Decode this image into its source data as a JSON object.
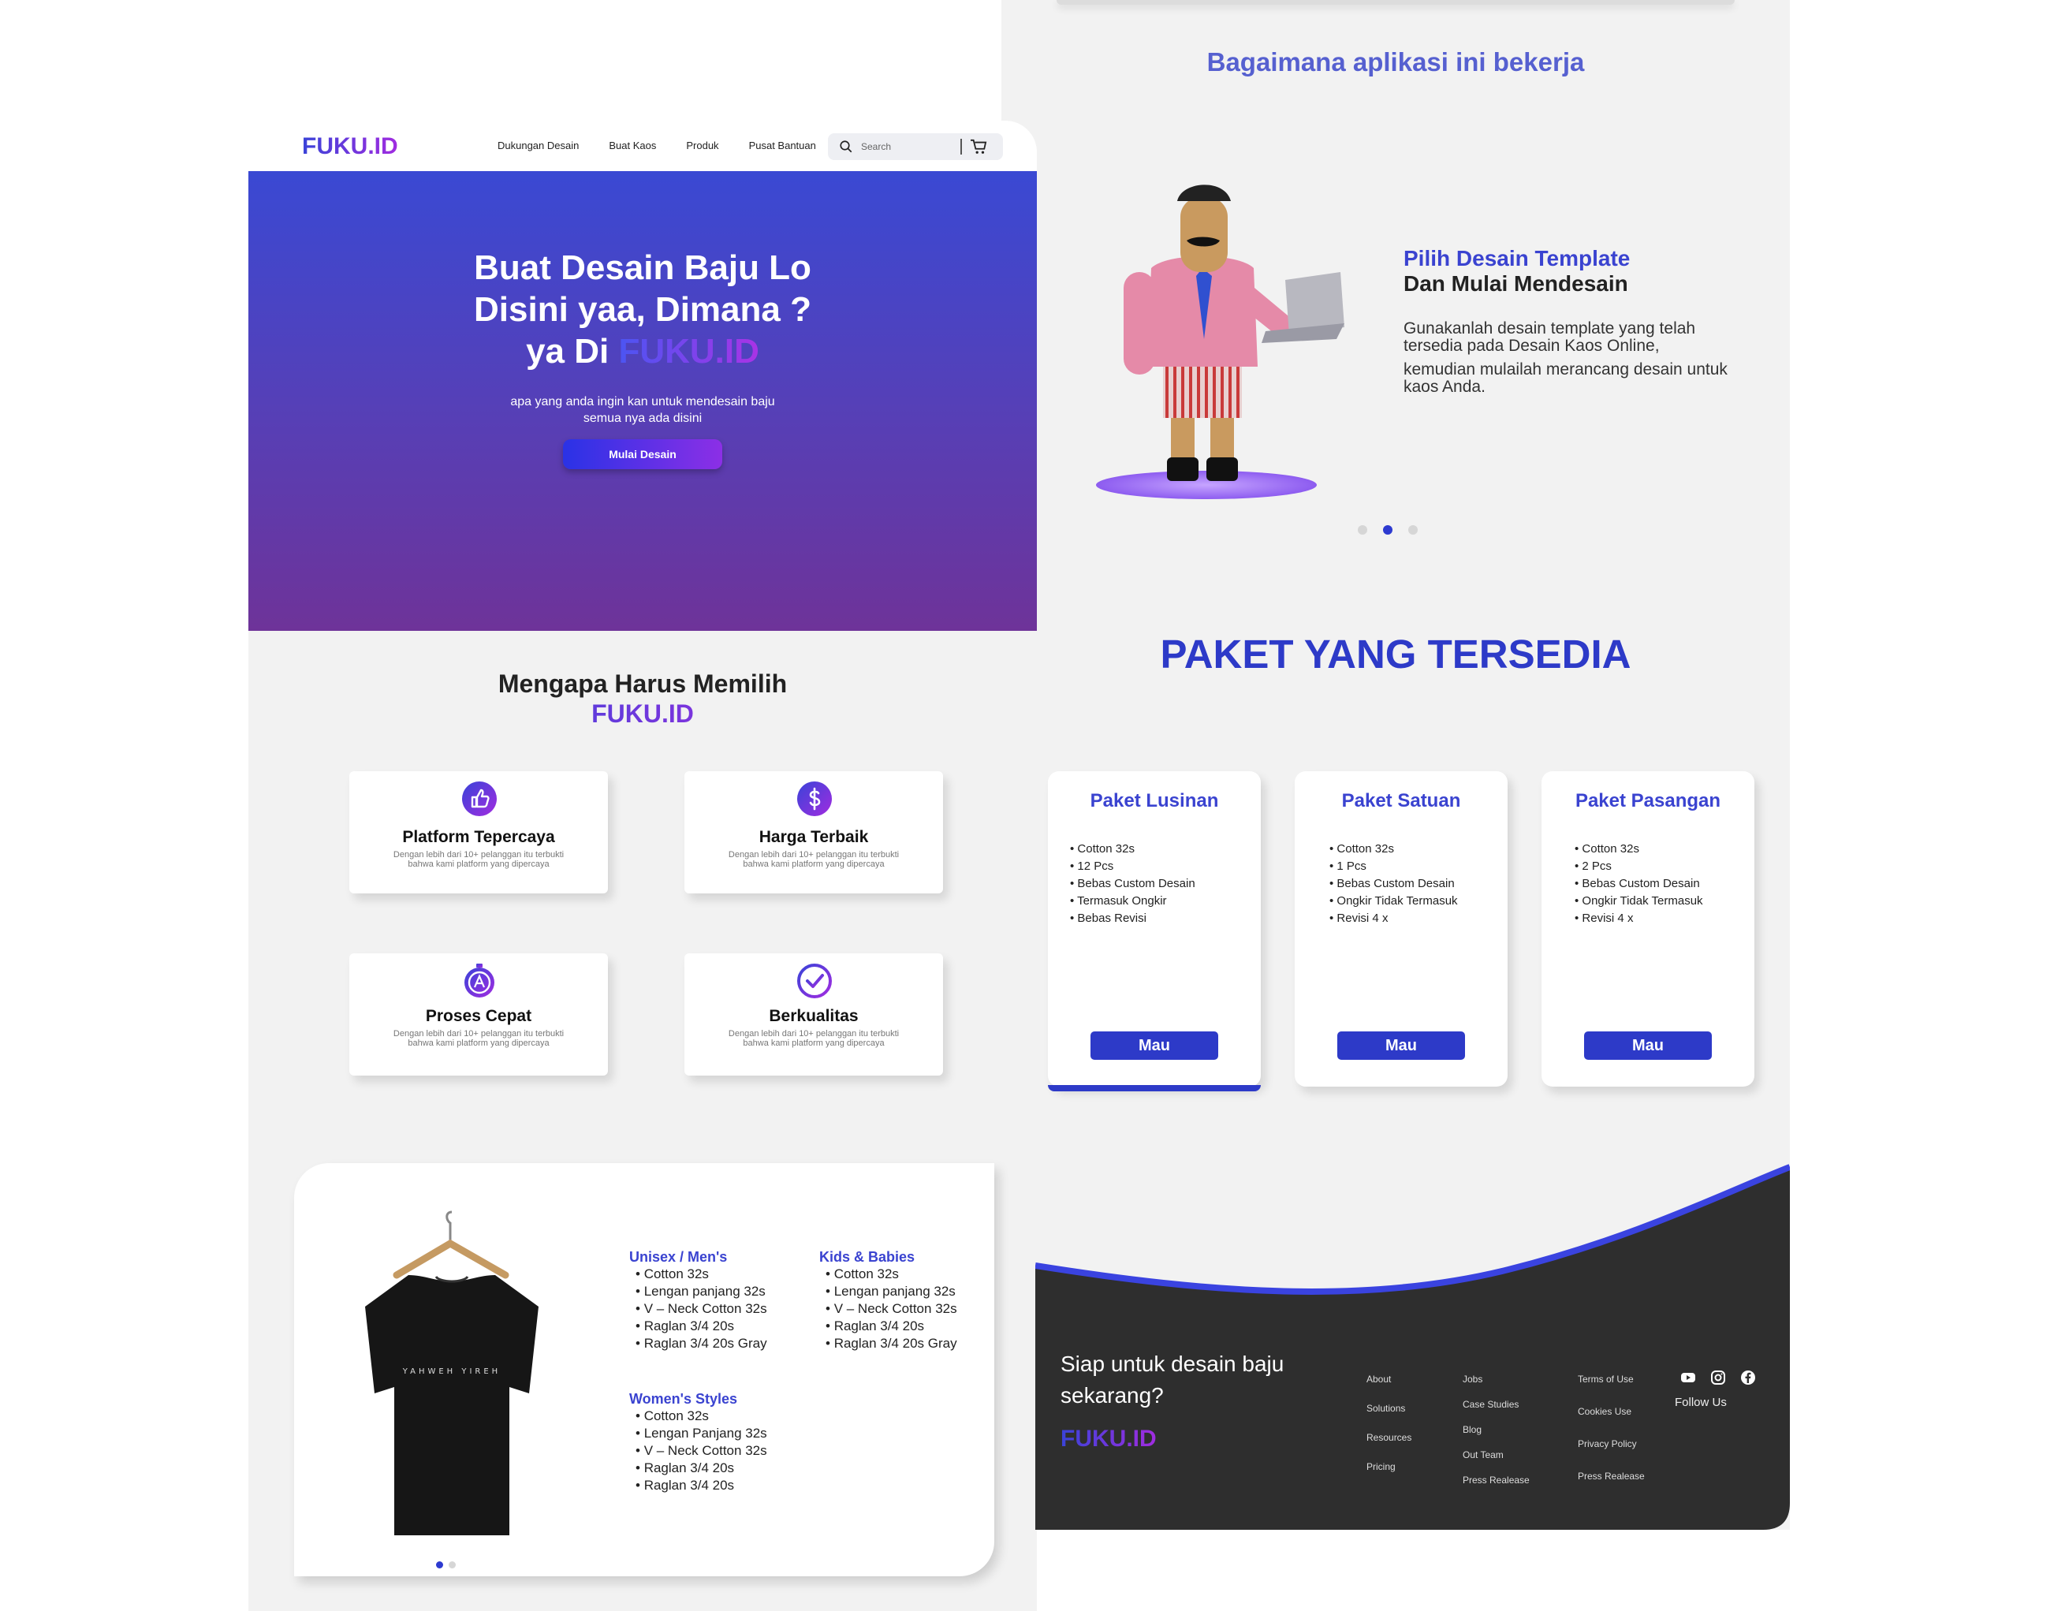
{
  "nav": {
    "logo": "FUKU.ID",
    "links": [
      "Dukungan Desain",
      "Buat Kaos",
      "Produk",
      "Pusat Bantuan"
    ],
    "search_placeholder": "Search"
  },
  "hero": {
    "line1": "Buat Desain Baju Lo",
    "line2": "Disini yaa, Dimana ?",
    "line3_prefix": "ya Di ",
    "line3_accent": "FUKU.ID",
    "sub1": "apa yang anda ingin kan untuk mendesain baju",
    "sub2": "semua nya ada disini",
    "cta": "Mulai Desain"
  },
  "why": {
    "title": "Mengapa Harus Memilih",
    "logo": "FUKU.ID",
    "cards": [
      {
        "title": "Platform Tepercaya",
        "desc": "Dengan lebih dari 10+ pelanggan itu terbukti bahwa kami platform yang dipercaya",
        "icon": "thumbs-up-icon"
      },
      {
        "title": "Harga Terbaik",
        "desc": "Dengan lebih dari 10+ pelanggan itu terbukti bahwa kami platform yang dipercaya",
        "icon": "dollar-icon"
      },
      {
        "title": "Proses Cepat",
        "desc": "Dengan lebih dari 10+ pelanggan itu terbukti bahwa kami platform yang dipercaya",
        "icon": "stopwatch-icon"
      },
      {
        "title": "Berkualitas",
        "desc": "Dengan lebih dari 10+ pelanggan itu terbukti bahwa kami platform yang dipercaya",
        "icon": "check-circle-icon"
      }
    ]
  },
  "shirt": {
    "print": "YAHWEH YIREH",
    "categories": [
      {
        "title": "Unisex / Men's",
        "items": [
          "Cotton 32s",
          "Lengan panjang 32s",
          "V – Neck Cotton 32s",
          "Raglan 3/4 20s",
          "Raglan 3/4 20s Gray"
        ]
      },
      {
        "title": "Kids & Babies",
        "items": [
          "Cotton 32s",
          "Lengan panjang 32s",
          "V – Neck Cotton 32s",
          "Raglan 3/4 20s",
          "Raglan 3/4 20s Gray"
        ]
      },
      {
        "title": "Women's Styles",
        "items": [
          "Cotton 32s",
          "Lengan Panjang 32s",
          "V – Neck Cotton 32s",
          "Raglan 3/4 20s",
          "Raglan 3/4 20s"
        ]
      }
    ]
  },
  "how": {
    "title": "Bagaimana aplikasi ini bekerja",
    "heading1": "Pilih Desain Template",
    "heading2": "Dan Mulai Mendesain",
    "para1": "Gunakanlah desain template yang telah tersedia pada Desain Kaos Online,",
    "para2": "kemudian mulailah merancang desain untuk kaos Anda."
  },
  "paket": {
    "title": "PAKET YANG TERSEDIA",
    "packages": [
      {
        "name": "Paket Lusinan",
        "items": [
          "Cotton 32s",
          "12 Pcs",
          "Bebas Custom Desain",
          "Termasuk Ongkir",
          "Bebas Revisi"
        ],
        "button": "Mau"
      },
      {
        "name": "Paket Satuan",
        "items": [
          "Cotton 32s",
          "1 Pcs",
          "Bebas Custom Desain",
          "Ongkir Tidak Termasuk",
          "Revisi 4 x"
        ],
        "button": "Mau"
      },
      {
        "name": "Paket Pasangan",
        "items": [
          "Cotton 32s",
          "2 Pcs",
          "Bebas Custom Desain",
          "Ongkir Tidak Termasuk",
          "Revisi 4 x"
        ],
        "button": "Mau"
      }
    ]
  },
  "footer": {
    "cta": "Siap untuk desain baju sekarang?",
    "logo": "FUKU.ID",
    "col1": [
      "About",
      "Solutions",
      "Resources",
      "Pricing"
    ],
    "col2": [
      "Jobs",
      "Case Studies",
      "Blog",
      "Out Team",
      "Press Realease"
    ],
    "col3": [
      "Terms of Use",
      "Cookies Use",
      "Privacy Policy",
      "Press Realease"
    ],
    "follow": "Follow Us"
  },
  "colors": {
    "brand": "#3a43d0",
    "accent_purple": "#a12ce0",
    "footer_bg": "#2e2e2e"
  }
}
